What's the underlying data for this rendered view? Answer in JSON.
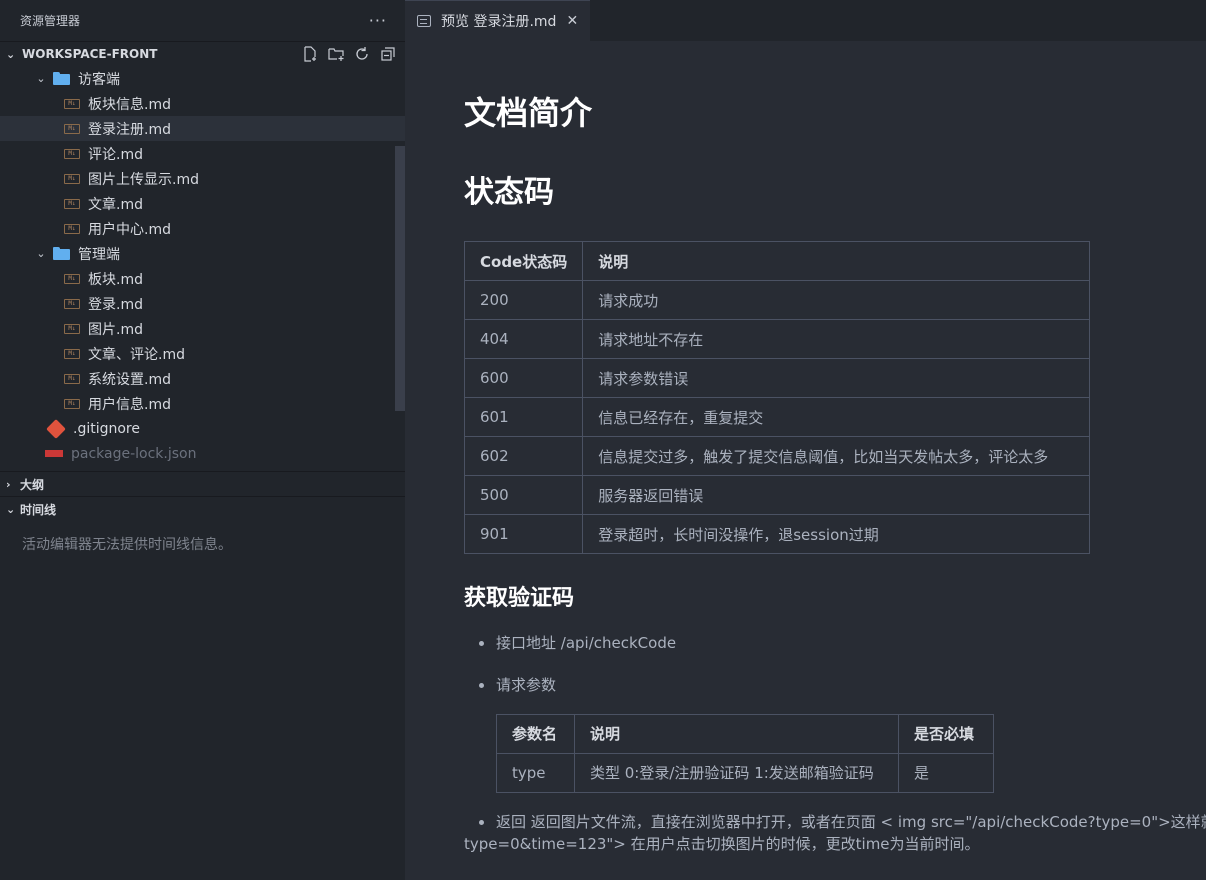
{
  "sidebar": {
    "title": "资源管理器",
    "more": "···",
    "workspace": "WORKSPACE-FRONT",
    "tree": [
      {
        "type": "folder",
        "label": "访客端",
        "indent": 1
      },
      {
        "type": "md",
        "label": "板块信息.md"
      },
      {
        "type": "md",
        "label": "登录注册.md",
        "selected": true
      },
      {
        "type": "md",
        "label": "评论.md"
      },
      {
        "type": "md",
        "label": "图片上传显示.md"
      },
      {
        "type": "md",
        "label": "文章.md"
      },
      {
        "type": "md",
        "label": "用户中心.md"
      },
      {
        "type": "folder",
        "label": "管理端"
      },
      {
        "type": "md",
        "label": "板块.md"
      },
      {
        "type": "md",
        "label": "登录.md"
      },
      {
        "type": "md",
        "label": "图片.md"
      },
      {
        "type": "md",
        "label": "文章、评论.md"
      },
      {
        "type": "md",
        "label": "系统设置.md"
      },
      {
        "type": "md",
        "label": "用户信息.md"
      },
      {
        "type": "git",
        "label": ".gitignore"
      },
      {
        "type": "npm",
        "label": "package-lock.json"
      }
    ],
    "outline": "大纲",
    "timeline": "时间线",
    "timeline_msg": "活动编辑器无法提供时间线信息。"
  },
  "tab": {
    "label": "预览 登录注册.md",
    "close": "✕"
  },
  "doc": {
    "h1": "文档简介",
    "h2": "状态码",
    "status_table": {
      "headers": [
        "Code状态码",
        "说明"
      ],
      "rows": [
        [
          "200",
          "请求成功"
        ],
        [
          "404",
          "请求地址不存在"
        ],
        [
          "600",
          "请求参数错误"
        ],
        [
          "601",
          "信息已经存在，重复提交"
        ],
        [
          "602",
          "信息提交过多，触发了提交信息阈值，比如当天发帖太多，评论太多"
        ],
        [
          "500",
          "服务器返回错误"
        ],
        [
          "901",
          "登录超时，长时间没操作，退session过期"
        ]
      ]
    },
    "h3": "获取验证码",
    "bullet_addr": "接口地址 /api/checkCode",
    "bullet_params": "请求参数",
    "params_table": {
      "headers": [
        "参数名",
        "说明",
        "是否必填"
      ],
      "rows": [
        [
          "type",
          "类型 0:登录/注册验证码 1:发送邮箱验证码",
          "是"
        ]
      ]
    },
    "bullet_return_line1": "返回 返回图片文件流，直接在浏览器中打开，或者在页面 < img src=\"/api/checkCode?type=0\">这样就",
    "bullet_return_line2": "type=0&time=123\"> 在用户点击切换图片的时候，更改time为当前时间。"
  }
}
